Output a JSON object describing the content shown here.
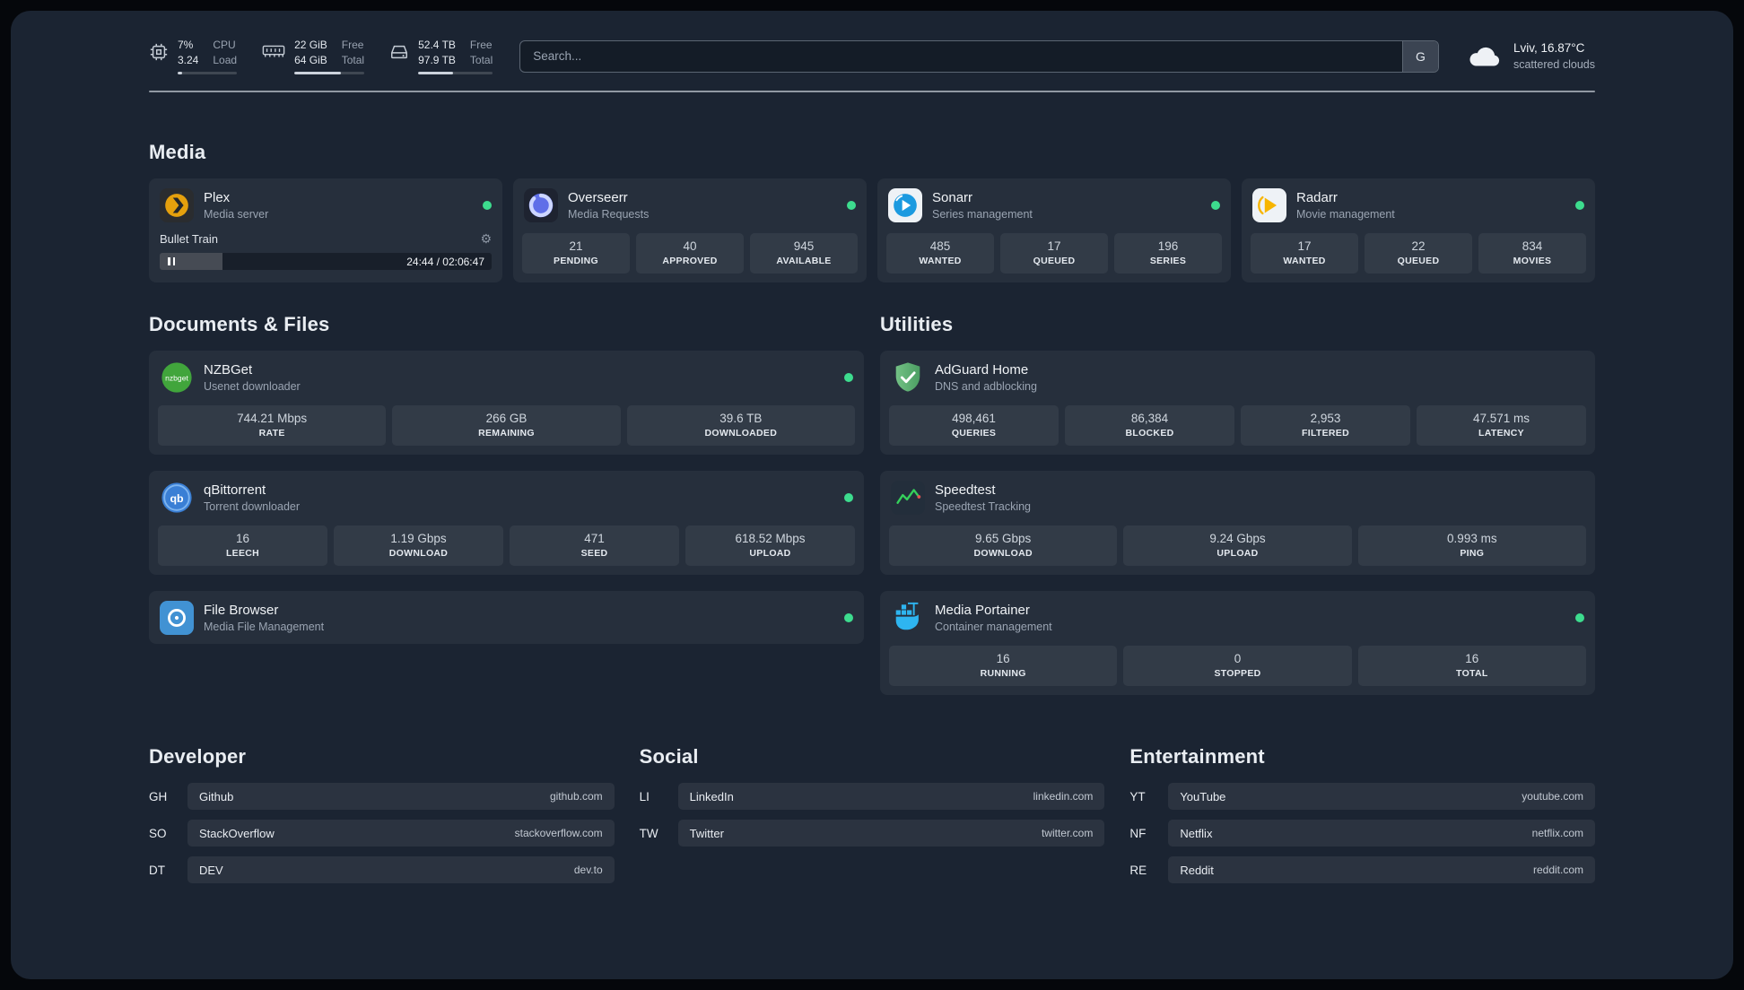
{
  "colors": {
    "background": "#1b2432",
    "card": "rgba(255,255,255,0.05)",
    "status_online": "#3ddc8e",
    "plex_amber": "#e5a00d",
    "sonarr_blue": "#1b9ae0",
    "radarr_amber": "#ffc230",
    "adguard_green": "#5fb570",
    "portainer_blue": "#29b6f6"
  },
  "topbar": {
    "resources": [
      {
        "icon": "cpu-icon",
        "values": [
          "7%",
          "3.24"
        ],
        "labels": [
          "CPU",
          "Load"
        ],
        "progress_pct": 7
      },
      {
        "icon": "memory-icon",
        "values": [
          "22 GiB",
          "64 GiB"
        ],
        "labels": [
          "Free",
          "Total"
        ],
        "progress_pct": 66
      },
      {
        "icon": "disk-icon",
        "values": [
          "52.4 TB",
          "97.9 TB"
        ],
        "labels": [
          "Free",
          "Total"
        ],
        "progress_pct": 47
      }
    ],
    "search": {
      "placeholder": "Search...",
      "provider_button": "G"
    },
    "weather": {
      "icon": "cloud-icon",
      "location": "Lviv, 16.87°C",
      "condition": "scattered clouds"
    }
  },
  "sections": {
    "media": {
      "heading": "Media",
      "services": [
        {
          "icon": "plex-icon",
          "title": "Plex",
          "subtitle": "Media server",
          "online": true,
          "player": {
            "track": "Bullet Train",
            "time": "24:44 / 02:06:47",
            "progress_pct": 19
          }
        },
        {
          "icon": "overseerr-icon",
          "title": "Overseerr",
          "subtitle": "Media Requests",
          "online": true,
          "stats": [
            {
              "value": "21",
              "label": "PENDING"
            },
            {
              "value": "40",
              "label": "APPROVED"
            },
            {
              "value": "945",
              "label": "AVAILABLE"
            }
          ]
        },
        {
          "icon": "sonarr-icon",
          "title": "Sonarr",
          "subtitle": "Series management",
          "online": true,
          "stats": [
            {
              "value": "485",
              "label": "WANTED"
            },
            {
              "value": "17",
              "label": "QUEUED"
            },
            {
              "value": "196",
              "label": "SERIES"
            }
          ]
        },
        {
          "icon": "radarr-icon",
          "title": "Radarr",
          "subtitle": "Movie management",
          "online": true,
          "stats": [
            {
              "value": "17",
              "label": "WANTED"
            },
            {
              "value": "22",
              "label": "QUEUED"
            },
            {
              "value": "834",
              "label": "MOVIES"
            }
          ]
        }
      ]
    },
    "documents": {
      "heading": "Documents & Files",
      "services": [
        {
          "icon": "nzbget-icon",
          "icon_text": "nzbget",
          "title": "NZBGet",
          "subtitle": "Usenet downloader",
          "online": true,
          "stats": [
            {
              "value": "744.21 Mbps",
              "label": "RATE"
            },
            {
              "value": "266 GB",
              "label": "REMAINING"
            },
            {
              "value": "39.6 TB",
              "label": "DOWNLOADED"
            }
          ]
        },
        {
          "icon": "qbittorrent-icon",
          "icon_text": "qb",
          "title": "qBittorrent",
          "subtitle": "Torrent downloader",
          "online": true,
          "stats": [
            {
              "value": "16",
              "label": "LEECH"
            },
            {
              "value": "1.19 Gbps",
              "label": "DOWNLOAD"
            },
            {
              "value": "471",
              "label": "SEED"
            },
            {
              "value": "618.52 Mbps",
              "label": "UPLOAD"
            }
          ]
        },
        {
          "icon": "filebrowser-icon",
          "title": "File Browser",
          "subtitle": "Media File Management",
          "online": true
        }
      ]
    },
    "utilities": {
      "heading": "Utilities",
      "services": [
        {
          "icon": "adguard-icon",
          "title": "AdGuard Home",
          "subtitle": "DNS and adblocking",
          "online": false,
          "stats": [
            {
              "value": "498,461",
              "label": "QUERIES"
            },
            {
              "value": "86,384",
              "label": "BLOCKED"
            },
            {
              "value": "2,953",
              "label": "FILTERED"
            },
            {
              "value": "47.571 ms",
              "label": "LATENCY"
            }
          ]
        },
        {
          "icon": "speedtest-icon",
          "title": "Speedtest",
          "subtitle": "Speedtest Tracking",
          "online": false,
          "stats": [
            {
              "value": "9.65 Gbps",
              "label": "DOWNLOAD"
            },
            {
              "value": "9.24 Gbps",
              "label": "UPLOAD"
            },
            {
              "value": "0.993 ms",
              "label": "PING"
            }
          ]
        },
        {
          "icon": "portainer-icon",
          "title": "Media Portainer",
          "subtitle": "Container management",
          "online": true,
          "stats": [
            {
              "value": "16",
              "label": "RUNNING"
            },
            {
              "value": "0",
              "label": "STOPPED"
            },
            {
              "value": "16",
              "label": "TOTAL"
            }
          ]
        }
      ]
    },
    "bookmarks": [
      {
        "heading": "Developer",
        "links": [
          {
            "abbr": "GH",
            "name": "Github",
            "url": "github.com"
          },
          {
            "abbr": "SO",
            "name": "StackOverflow",
            "url": "stackoverflow.com"
          },
          {
            "abbr": "DT",
            "name": "DEV",
            "url": "dev.to"
          }
        ]
      },
      {
        "heading": "Social",
        "links": [
          {
            "abbr": "LI",
            "name": "LinkedIn",
            "url": "linkedin.com"
          },
          {
            "abbr": "TW",
            "name": "Twitter",
            "url": "twitter.com"
          }
        ]
      },
      {
        "heading": "Entertainment",
        "links": [
          {
            "abbr": "YT",
            "name": "YouTube",
            "url": "youtube.com"
          },
          {
            "abbr": "NF",
            "name": "Netflix",
            "url": "netflix.com"
          },
          {
            "abbr": "RE",
            "name": "Reddit",
            "url": "reddit.com"
          }
        ]
      }
    ]
  }
}
